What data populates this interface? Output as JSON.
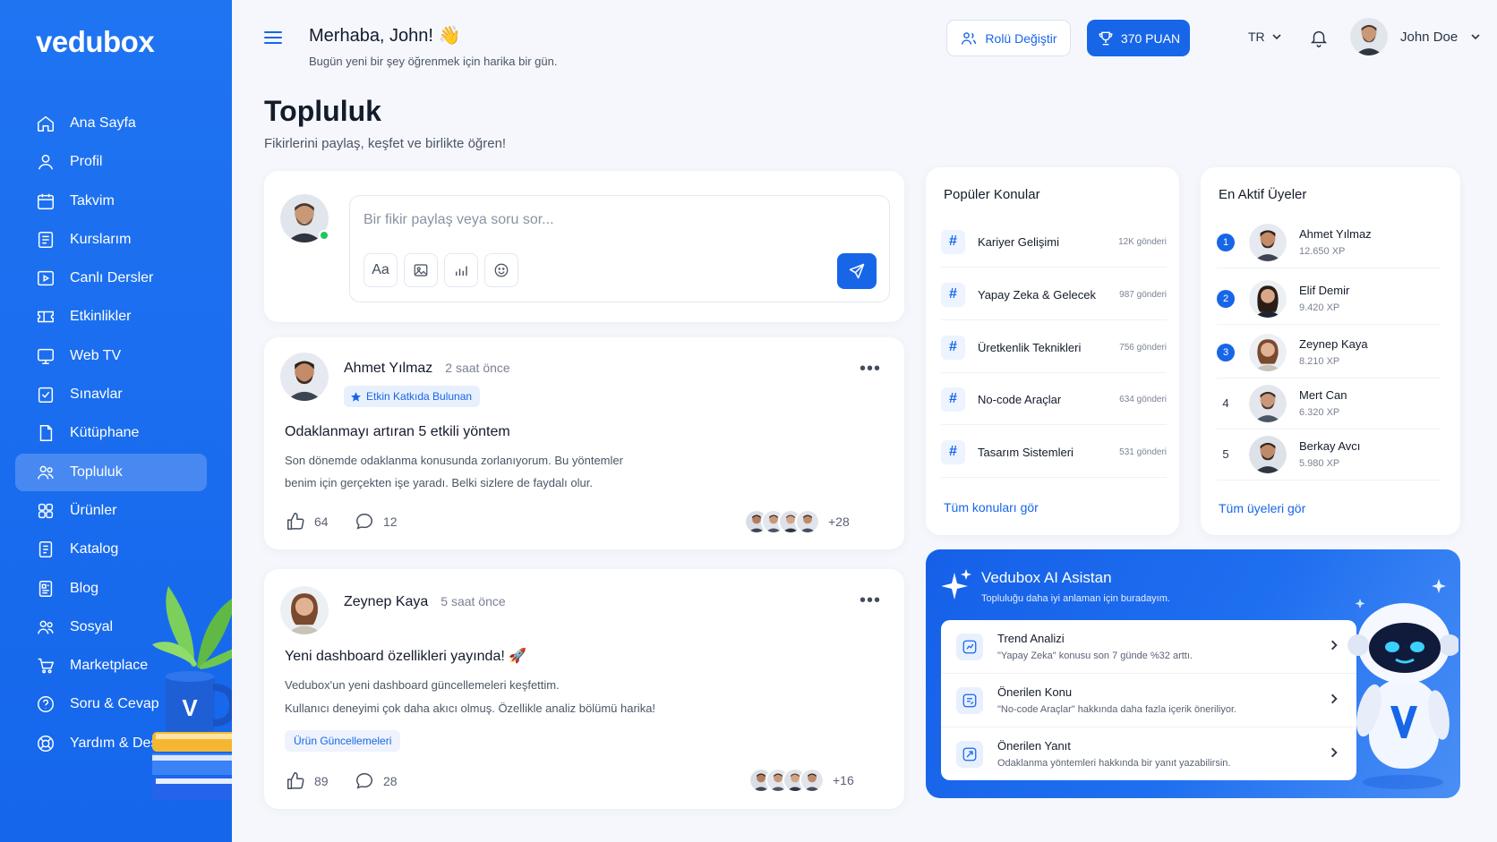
{
  "app": {
    "logo": "vedubox"
  },
  "sidebar": {
    "items": [
      {
        "label": "Ana Sayfa",
        "icon": "home-icon"
      },
      {
        "label": "Profil",
        "icon": "user-icon"
      },
      {
        "label": "Takvim",
        "icon": "calendar-icon"
      },
      {
        "label": "Kurslarım",
        "icon": "courses-icon"
      },
      {
        "label": "Canlı Dersler",
        "icon": "live-icon"
      },
      {
        "label": "Etkinlikler",
        "icon": "ticket-icon"
      },
      {
        "label": "Web TV",
        "icon": "tv-icon"
      },
      {
        "label": "Sınavlar",
        "icon": "exam-icon"
      },
      {
        "label": "Kütüphane",
        "icon": "library-icon"
      },
      {
        "label": "Topluluk",
        "icon": "community-icon",
        "active": true
      },
      {
        "label": "Ürünler",
        "icon": "products-icon"
      },
      {
        "label": "Katalog",
        "icon": "catalog-icon"
      },
      {
        "label": "Blog",
        "icon": "blog-icon"
      },
      {
        "label": "Sosyal",
        "icon": "social-icon"
      },
      {
        "label": "Marketplace",
        "icon": "cart-icon"
      },
      {
        "label": "Soru & Cevap",
        "icon": "question-icon"
      },
      {
        "label": "Yardım & Destek",
        "icon": "support-icon"
      }
    ]
  },
  "header": {
    "greeting": "Merhaba, John! 👋",
    "subtitle": "Bugün yeni bir şey öğrenmek için harika bir gün.",
    "role_button": "Rolü Değiştir",
    "points_button": "370 PUAN",
    "language": "TR",
    "user_name": "John Doe"
  },
  "page": {
    "title": "Topluluk",
    "subtitle": "Fikirlerini paylaş, keşfet ve birlikte öğren!"
  },
  "composer": {
    "placeholder": "Bir fikir paylaş veya soru sor...",
    "text_tool": "Aa"
  },
  "posts": [
    {
      "author": "Ahmet Yılmaz",
      "time": "2 saat önce",
      "badge": "Etkin Katkıda Bulunan",
      "title": "Odaklanmayı artıran 5 etkili yöntem",
      "body_line1": "Son dönemde odaklanma konusunda zorlanıyorum. Bu yöntemler",
      "body_line2": "benim için gerçekten işe yaradı. Belki sizlere de faydalı olur.",
      "likes": "64",
      "comments": "12",
      "more_count": "+28"
    },
    {
      "author": "Zeynep Kaya",
      "time": "5 saat önce",
      "title": "Yeni dashboard özellikleri yayında! 🚀",
      "body_line1": "Vedubox'un yeni dashboard güncellemeleri keşfettim.",
      "body_line2": "Kullanıcı deneyimi çok daha akıcı olmuş. Özellikle analiz bölümü harika!",
      "tag": "Ürün Güncellemeleri",
      "likes": "89",
      "comments": "28",
      "more_count": "+16"
    }
  ],
  "popular": {
    "title": "Popüler Konular",
    "topics": [
      {
        "name": "Kariyer Gelişimi",
        "count": "12K gönderi"
      },
      {
        "name": "Yapay Zeka & Gelecek",
        "count": "987 gönderi"
      },
      {
        "name": "Üretkenlik Teknikleri",
        "count": "756 gönderi"
      },
      {
        "name": "No-code Araçlar",
        "count": "634 gönderi"
      },
      {
        "name": "Tasarım Sistemleri",
        "count": "531 gönderi"
      }
    ],
    "see_all": "Tüm konuları gör"
  },
  "members": {
    "title": "En Aktif Üyeler",
    "list": [
      {
        "rank": "1",
        "name": "Ahmet Yılmaz",
        "xp": "12.650 XP"
      },
      {
        "rank": "2",
        "name": "Elif Demir",
        "xp": "9.420 XP"
      },
      {
        "rank": "3",
        "name": "Zeynep Kaya",
        "xp": "8.210 XP"
      },
      {
        "rank": "4",
        "name": "Mert Can",
        "xp": "6.320 XP"
      },
      {
        "rank": "5",
        "name": "Berkay Avcı",
        "xp": "5.980 XP"
      }
    ],
    "see_all": "Tüm üyeleri gör"
  },
  "ai": {
    "title": "Vedubox AI Asistan",
    "subtitle": "Topluluğu daha iyi anlaman için buradayım.",
    "items": [
      {
        "title": "Trend Analizi",
        "desc": "\"Yapay Zeka\" konusu son 7 günde %32 arttı."
      },
      {
        "title": "Önerilen Konu",
        "desc": "\"No-code Araçlar\" hakkında daha fazla içerik öneriliyor."
      },
      {
        "title": "Önerilen Yanıt",
        "desc": "Odaklanma yöntemleri hakkında bir yanıt yazabilirsin."
      }
    ]
  },
  "colors": {
    "primary": "#1766e8",
    "sidebar": "#1f74f2",
    "online": "#22c55e"
  }
}
